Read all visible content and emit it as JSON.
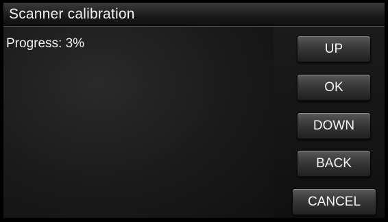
{
  "title": "Scanner calibration",
  "status": {
    "progress_text": "Progress: 3%",
    "progress_percent": 3
  },
  "buttons": {
    "up": "UP",
    "ok": "OK",
    "down": "DOWN",
    "back": "BACK",
    "cancel": "CANCEL"
  },
  "colors": {
    "background": "#000000",
    "text": "#f2f2f2",
    "button_top": "#5a5a5a",
    "button_bottom": "#1f1f1f"
  }
}
